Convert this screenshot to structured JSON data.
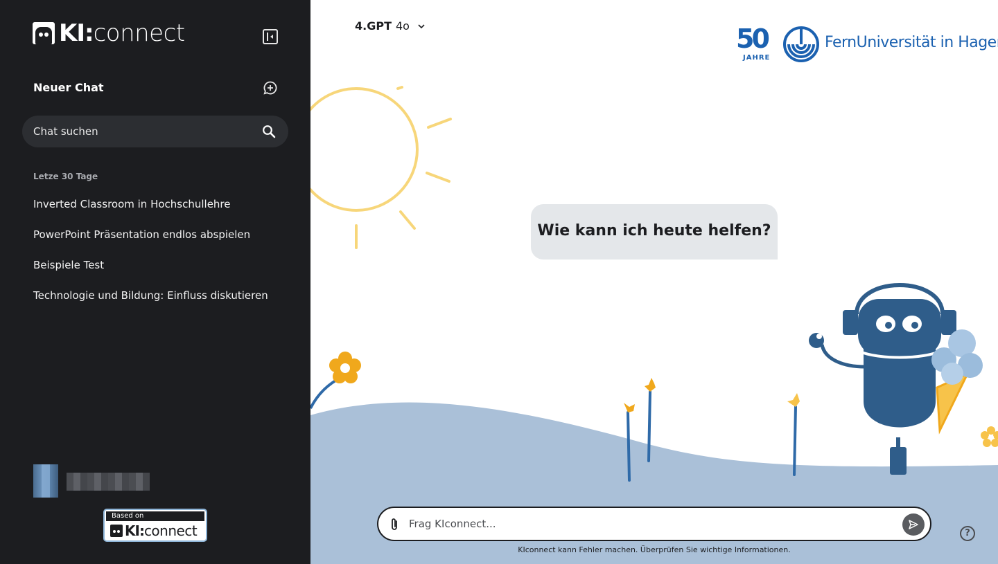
{
  "app": {
    "brand_prefix": "KI:",
    "brand_suffix": "connect"
  },
  "sidebar": {
    "new_chat_label": "Neuer Chat",
    "search_placeholder": "Chat suchen",
    "section_label": "Letze 30 Tage",
    "chats": [
      {
        "label": "Inverted Classroom in Hochschullehre"
      },
      {
        "label": "PowerPoint Präsentation endlos abspielen"
      },
      {
        "label": "Beispiele Test"
      },
      {
        "label": "Technologie und Bildung: Einfluss diskutieren"
      }
    ],
    "based_on": {
      "label": "Based on",
      "brand_prefix": "KI:",
      "brand_suffix": "connect"
    }
  },
  "header": {
    "model_name": "4.GPT",
    "model_version": "4o",
    "org_anniversary": "50",
    "org_anniversary_label": "JAHRE",
    "org_name": "FernUniversität in Hagen"
  },
  "main": {
    "greeting": "Wie kann ich heute helfen?",
    "composer_placeholder": "Frag KIconnect...",
    "disclaimer": "KIconnect kann Fehler machen. Überprüfen Sie wichtige Informationen.",
    "help_label": "?"
  },
  "colors": {
    "sidebar_bg": "#1c1d20",
    "accent_blue": "#1b61b0",
    "robot_blue": "#2f5d8a",
    "hill": "#aac0d8",
    "sun": "#f7d67a",
    "flower": "#f0a81c"
  }
}
